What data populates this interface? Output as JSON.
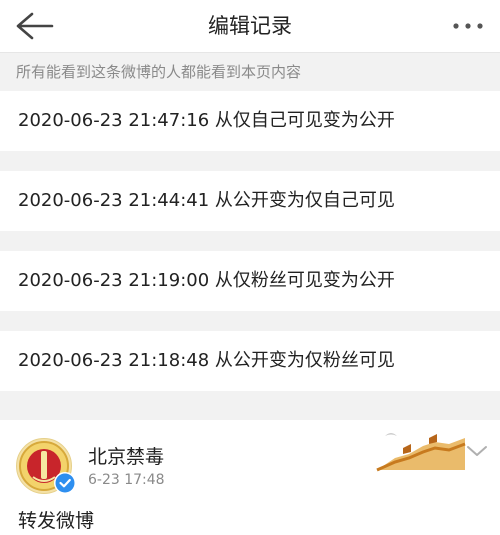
{
  "header": {
    "title": "编辑记录",
    "back_icon": "arrow-left-icon",
    "more_icon": "more-horizontal-icon"
  },
  "notice": "所有能看到这条微博的人都能看到本页内容",
  "records": [
    {
      "text": "2020-06-23 21:47:16 从仅自己可见变为公开"
    },
    {
      "text": "2020-06-23 21:44:41 从公开变为仅自己可见"
    },
    {
      "text": "2020-06-23 21:19:00 从仅粉丝可见变为公开"
    },
    {
      "text": "2020-06-23 21:18:48 从公开变为仅粉丝可见"
    }
  ],
  "post": {
    "username": "北京禁毒",
    "time": "6-23 17:48",
    "text": "转发微博",
    "verified_icon": "verified-check-icon",
    "chevron_icon": "chevron-down-icon"
  },
  "colors": {
    "accent_blue": "#2e8ff0",
    "muted_text": "#8a8a8a",
    "background": "#f2f2f2"
  }
}
